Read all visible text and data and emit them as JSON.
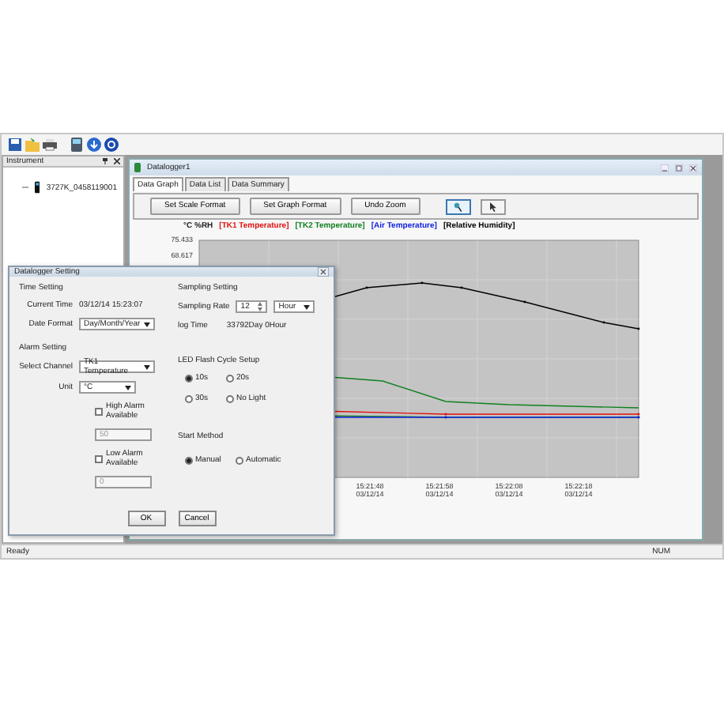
{
  "instrument_panel": {
    "title": "Instrument",
    "tree": [
      {
        "label": "3727K_0458119001"
      }
    ]
  },
  "child_window": {
    "title": "Datalogger1",
    "tabs": [
      {
        "label": "Data Graph",
        "selected": true
      },
      {
        "label": "Data List",
        "selected": false
      },
      {
        "label": "Data Summary",
        "selected": false
      }
    ],
    "buttons": [
      "Set Scale Format",
      "Set Graph Format",
      "Undo Zoom"
    ],
    "tool_buttons": [
      {
        "kind": "zoom",
        "selected": true
      },
      {
        "kind": "pointer",
        "selected": false
      }
    ],
    "unit_label": "°C %RH",
    "legend": [
      {
        "label": "[TK1 Temperature]",
        "color": "#e01010"
      },
      {
        "label": "[TK2 Temperature]",
        "color": "#108020"
      },
      {
        "label": "[Air Temperature]",
        "color": "#1020e0"
      },
      {
        "label": "[Relative Humidity]",
        "color": "#000000"
      }
    ],
    "graph": {
      "y_tick_labels": [
        "75.433",
        "68.617"
      ],
      "x_tick_labels": [
        {
          "time": "15:21:48",
          "date": "03/12/14"
        },
        {
          "time": "15:21:58",
          "date": "03/12/14"
        },
        {
          "time": "15:22:08",
          "date": "03/12/14"
        },
        {
          "time": "15:22:18",
          "date": "03/12/14"
        }
      ]
    }
  },
  "dialog": {
    "title": "Datalogger Setting",
    "time_setting": {
      "title": "Time Setting",
      "current_time_label": "Current Time",
      "current_time": "03/12/14 15:23:07",
      "date_format_label": "Date Format",
      "date_format": "Day/Month/Year"
    },
    "sampling_setting": {
      "title": "Sampling Setting",
      "rate_label": "Sampling Rate",
      "rate": "12",
      "rate_unit": "Hour",
      "log_time_label": "log Time",
      "log_time": "33792Day 0Hour"
    },
    "alarm_setting": {
      "title": "Alarm Setting",
      "channel_label": "Select Channel",
      "channel": "TK1 Temperature",
      "unit_label": "Unit",
      "unit": "°C",
      "alarms": [
        {
          "label": "High Alarm Available",
          "checked": false,
          "value": "50"
        },
        {
          "label": "Low Alarm Available",
          "checked": false,
          "value": "0"
        }
      ]
    },
    "led_setup": {
      "title": "LED Flash Cycle Setup",
      "options": [
        {
          "label": "10s",
          "selected": true
        },
        {
          "label": "20s",
          "selected": false
        },
        {
          "label": "30s",
          "selected": false
        },
        {
          "label": "No Light",
          "selected": false
        }
      ]
    },
    "start_method": {
      "title": "Start Method",
      "options": [
        {
          "label": "Manual",
          "selected": true
        },
        {
          "label": "Automatic",
          "selected": false
        }
      ]
    },
    "buttons": [
      "OK",
      "Cancel"
    ]
  },
  "status_bar": {
    "left": "Ready",
    "right": "NUM"
  }
}
